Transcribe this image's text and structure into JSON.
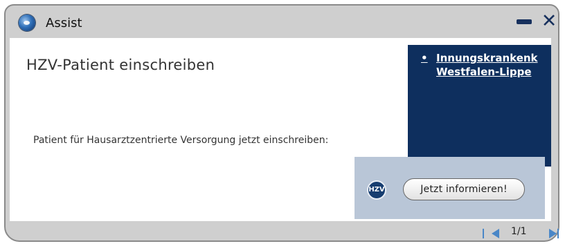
{
  "window": {
    "title": "Assist",
    "icon": "globe-icon",
    "controls": {
      "minimize_icon": "minimize-icon",
      "close_label": "✕"
    }
  },
  "main": {
    "heading": "HZV-Patient einschreiben",
    "body": "Patient für Hausarztzentrierte Versorgung jetzt einschreiben:"
  },
  "side_panel": {
    "bullet": "•",
    "link_line1": "Innungskrankenk",
    "link_line2": "Westfalen-Lippe"
  },
  "ad": {
    "badge": "HZV",
    "button_label": "Jetzt informieren!"
  },
  "pager": {
    "label": "1/1"
  },
  "colors": {
    "chrome_gray": "#cfcfcf",
    "navy": "#0e2f5e",
    "panel_blue": "#b9c6d7",
    "arrow_blue": "#4a87c7"
  }
}
